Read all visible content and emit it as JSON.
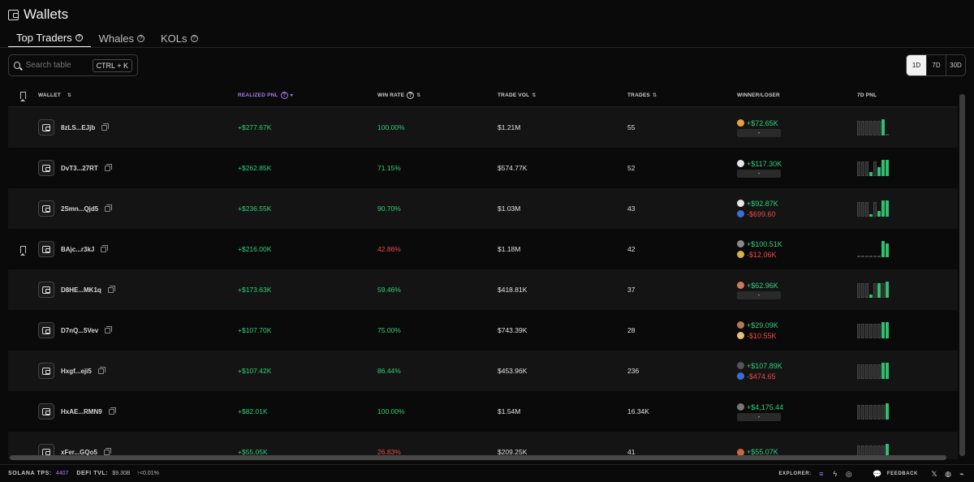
{
  "header": {
    "title": "Wallets"
  },
  "tabs": [
    {
      "label": "Top Traders",
      "active": true
    },
    {
      "label": "Whales",
      "active": false
    },
    {
      "label": "KOLs",
      "active": false
    }
  ],
  "search": {
    "placeholder": "Search table",
    "shortcut": "CTRL + K"
  },
  "timeframes": [
    {
      "label": "1D",
      "active": true
    },
    {
      "label": "7D",
      "active": false
    },
    {
      "label": "30D",
      "active": false
    }
  ],
  "columns": {
    "wallet": "WALLET",
    "realized_pnl": "REALIZED PNL",
    "win_rate": "WIN RATE",
    "trade_vol": "TRADE VOL",
    "trades": "TRADES",
    "winner_loser": "WINNER/LOSER",
    "pnl_7d": "7D PNL"
  },
  "colors": {
    "green": "#2fcf7c",
    "red": "#ef4b4b",
    "accent": "#a57cf2"
  },
  "rows": [
    {
      "wallet": "8zLS...EJjb",
      "pnl": "+$277.67K",
      "win_rate": "100.00%",
      "win_color": "green",
      "vol": "$1.21M",
      "trades": "55",
      "bookmarked": false,
      "winner": {
        "value": "+$72.65K",
        "token_color": "#e8a23a"
      },
      "loser": {
        "value": "-",
        "token_color": ""
      },
      "spark": [
        {
          "h": 0.9,
          "g": false
        },
        {
          "h": 0.9,
          "g": false
        },
        {
          "h": 0.9,
          "g": false
        },
        {
          "h": 0.9,
          "g": false
        },
        {
          "h": 0.9,
          "g": false
        },
        {
          "h": 0.9,
          "g": false
        },
        {
          "h": 1.0,
          "g": true
        },
        {
          "h": 0.05,
          "g": false
        }
      ]
    },
    {
      "wallet": "DvT3...27RT",
      "pnl": "+$262.85K",
      "win_rate": "71.15%",
      "win_color": "green",
      "vol": "$574.77K",
      "trades": "52",
      "bookmarked": false,
      "winner": {
        "value": "+$117.30K",
        "token_color": "#e6e6e6"
      },
      "loser": {
        "value": "-",
        "token_color": ""
      },
      "spark": [
        {
          "h": 0.9,
          "g": false
        },
        {
          "h": 0.9,
          "g": false
        },
        {
          "h": 0.9,
          "g": false
        },
        {
          "h": 0.25,
          "g": true
        },
        {
          "h": 0.9,
          "g": false
        },
        {
          "h": 0.55,
          "g": true
        },
        {
          "h": 1.0,
          "g": true
        },
        {
          "h": 1.0,
          "g": true
        }
      ]
    },
    {
      "wallet": "2Smn...Qjd5",
      "pnl": "+$236.55K",
      "win_rate": "90.70%",
      "win_color": "green",
      "vol": "$1.03M",
      "trades": "43",
      "bookmarked": false,
      "winner": {
        "value": "+$92.87K",
        "token_color": "#e6e6e6"
      },
      "loser": {
        "value": "-$699.60",
        "token_color": "#3a6fd8"
      },
      "spark": [
        {
          "h": 0.9,
          "g": false
        },
        {
          "h": 0.9,
          "g": false
        },
        {
          "h": 0.9,
          "g": false
        },
        {
          "h": 0.15,
          "g": true
        },
        {
          "h": 0.9,
          "g": false
        },
        {
          "h": 0.35,
          "g": true
        },
        {
          "h": 1.0,
          "g": true
        },
        {
          "h": 1.0,
          "g": true
        }
      ]
    },
    {
      "wallet": "BAjc...r3kJ",
      "pnl": "+$216.00K",
      "win_rate": "42.86%",
      "win_color": "red",
      "vol": "$1.18M",
      "trades": "42",
      "bookmarked": true,
      "winner": {
        "value": "+$100.51K",
        "token_color": "#8a8a8a"
      },
      "loser": {
        "value": "-$12.06K",
        "token_color": "#d9b23a"
      },
      "spark": [
        {
          "h": 0.05,
          "g": false
        },
        {
          "h": 0.05,
          "g": false
        },
        {
          "h": 0.05,
          "g": false
        },
        {
          "h": 0.05,
          "g": false
        },
        {
          "h": 0.05,
          "g": false
        },
        {
          "h": 0.05,
          "g": false
        },
        {
          "h": 1.0,
          "g": true
        },
        {
          "h": 0.85,
          "g": true
        }
      ]
    },
    {
      "wallet": "D8HE...MK1q",
      "pnl": "+$173.63K",
      "win_rate": "59.46%",
      "win_color": "green",
      "vol": "$418.81K",
      "trades": "37",
      "bookmarked": false,
      "winner": {
        "value": "+$62.96K",
        "token_color": "#c97a5a"
      },
      "loser": {
        "value": "-",
        "token_color": ""
      },
      "spark": [
        {
          "h": 0.9,
          "g": false
        },
        {
          "h": 0.9,
          "g": false
        },
        {
          "h": 0.9,
          "g": false
        },
        {
          "h": 0.2,
          "g": true
        },
        {
          "h": 0.9,
          "g": false
        },
        {
          "h": 0.9,
          "g": true
        },
        {
          "h": 0.9,
          "g": false
        },
        {
          "h": 1.0,
          "g": true
        }
      ]
    },
    {
      "wallet": "D7nQ...5Vev",
      "pnl": "+$107.70K",
      "win_rate": "75.00%",
      "win_color": "green",
      "vol": "$743.39K",
      "trades": "28",
      "bookmarked": false,
      "winner": {
        "value": "+$29.09K",
        "token_color": "#b07a5a"
      },
      "loser": {
        "value": "-$10.55K",
        "token_color": "#e6c07a"
      },
      "spark": [
        {
          "h": 0.9,
          "g": false
        },
        {
          "h": 0.9,
          "g": false
        },
        {
          "h": 0.9,
          "g": false
        },
        {
          "h": 0.9,
          "g": false
        },
        {
          "h": 0.9,
          "g": false
        },
        {
          "h": 0.9,
          "g": false
        },
        {
          "h": 1.0,
          "g": true
        },
        {
          "h": 1.0,
          "g": true
        }
      ]
    },
    {
      "wallet": "Hxgf...eji5",
      "pnl": "+$107.42K",
      "win_rate": "86.44%",
      "win_color": "green",
      "vol": "$453.96K",
      "trades": "236",
      "bookmarked": false,
      "winner": {
        "value": "+$107.89K",
        "token_color": "#555555"
      },
      "loser": {
        "value": "-$474.65",
        "token_color": "#3a6fd8"
      },
      "spark": [
        {
          "h": 0.9,
          "g": false
        },
        {
          "h": 0.9,
          "g": false
        },
        {
          "h": 0.9,
          "g": false
        },
        {
          "h": 0.9,
          "g": false
        },
        {
          "h": 0.9,
          "g": false
        },
        {
          "h": 0.9,
          "g": false
        },
        {
          "h": 1.0,
          "g": true
        },
        {
          "h": 1.0,
          "g": true
        }
      ]
    },
    {
      "wallet": "HxAE...RMN9",
      "pnl": "+$82.01K",
      "win_rate": "100.00%",
      "win_color": "green",
      "vol": "$1.54M",
      "trades": "16.34K",
      "bookmarked": false,
      "winner": {
        "value": "+$4,175.44",
        "token_color": "#777777"
      },
      "loser": {
        "value": "-",
        "token_color": ""
      },
      "spark": [
        {
          "h": 0.9,
          "g": false
        },
        {
          "h": 0.9,
          "g": false
        },
        {
          "h": 0.9,
          "g": false
        },
        {
          "h": 0.9,
          "g": false
        },
        {
          "h": 0.9,
          "g": false
        },
        {
          "h": 0.9,
          "g": false
        },
        {
          "h": 0.9,
          "g": false
        },
        {
          "h": 1.0,
          "g": true
        }
      ]
    },
    {
      "wallet": "xFer...GQo5",
      "pnl": "+$55.05K",
      "win_rate": "26.83%",
      "win_color": "red",
      "vol": "$209.25K",
      "trades": "41",
      "bookmarked": false,
      "winner": {
        "value": "+$55.07K",
        "token_color": "#c9683a"
      },
      "loser": {
        "value": "",
        "token_color": ""
      },
      "spark": [
        {
          "h": 0.9,
          "g": false
        },
        {
          "h": 0.9,
          "g": false
        },
        {
          "h": 0.9,
          "g": false
        },
        {
          "h": 0.9,
          "g": false
        },
        {
          "h": 0.9,
          "g": false
        },
        {
          "h": 0.9,
          "g": false
        },
        {
          "h": 0.9,
          "g": false
        },
        {
          "h": 1.0,
          "g": true
        }
      ]
    }
  ],
  "footer": {
    "tps_label": "SOLANA TPS:",
    "tps_value": "4407",
    "tvl_label": "DEFI TVL:",
    "tvl_value": "$9.30B",
    "tvl_change": "↑<0.01%",
    "explorer_label": "EXPLORER:",
    "feedback_label": "FEEDBACK"
  }
}
